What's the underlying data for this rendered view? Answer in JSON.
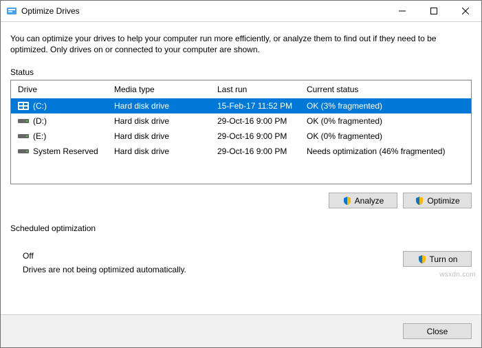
{
  "window": {
    "title": "Optimize Drives"
  },
  "intro": "You can optimize your drives to help your computer run more efficiently, or analyze them to find out if they need to be optimized. Only drives on or connected to your computer are shown.",
  "status_label": "Status",
  "columns": {
    "drive": "Drive",
    "media": "Media type",
    "last": "Last run",
    "status": "Current status"
  },
  "drives": [
    {
      "name": "(C:)",
      "media": "Hard disk drive",
      "last": "15-Feb-17 11:52 PM",
      "status": "OK (3% fragmented)",
      "selected": true,
      "icon": "win"
    },
    {
      "name": "(D:)",
      "media": "Hard disk drive",
      "last": "29-Oct-16 9:00 PM",
      "status": "OK (0% fragmented)",
      "selected": false,
      "icon": "hdd"
    },
    {
      "name": "(E:)",
      "media": "Hard disk drive",
      "last": "29-Oct-16 9:00 PM",
      "status": "OK (0% fragmented)",
      "selected": false,
      "icon": "hdd"
    },
    {
      "name": "System Reserved",
      "media": "Hard disk drive",
      "last": "29-Oct-16 9:00 PM",
      "status": "Needs optimization (46% fragmented)",
      "selected": false,
      "icon": "hdd"
    }
  ],
  "buttons": {
    "analyze": "Analyze",
    "optimize": "Optimize",
    "turnon": "Turn on",
    "close": "Close"
  },
  "scheduled": {
    "label": "Scheduled optimization",
    "state": "Off",
    "desc": "Drives are not being optimized automatically."
  },
  "watermark": "wsxdn.com"
}
